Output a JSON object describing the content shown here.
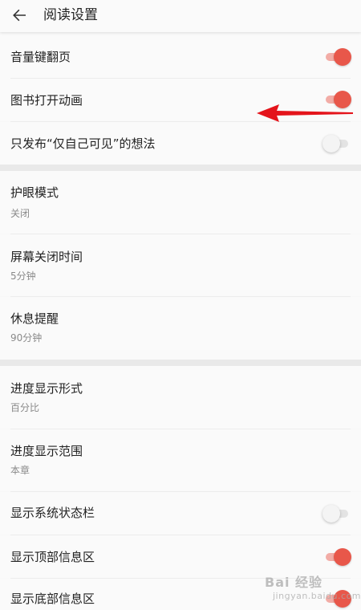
{
  "header": {
    "title": "阅读设置",
    "back_icon": "arrow-left-icon"
  },
  "section1": {
    "items": [
      {
        "label": "音量键翻页",
        "toggle_on": true
      },
      {
        "label": "图书打开动画",
        "toggle_on": true
      },
      {
        "label": "只发布“仅自己可见”的想法",
        "toggle_on": false
      }
    ]
  },
  "section2": {
    "items": [
      {
        "label": "护眼模式",
        "value": "关闭"
      },
      {
        "label": "屏幕关闭时间",
        "value": "5分钟"
      },
      {
        "label": "休息提醒",
        "value": "90分钟"
      }
    ]
  },
  "section3": {
    "items": [
      {
        "label": "进度显示形式",
        "value": "百分比"
      },
      {
        "label": "进度显示范围",
        "value": "本章"
      },
      {
        "label": "显示系统状态栏",
        "toggle_on": false
      },
      {
        "label": "显示顶部信息区",
        "toggle_on": true
      },
      {
        "label": "显示底部信息区",
        "toggle_on": true
      }
    ]
  },
  "colors": {
    "accent": "#e8574a",
    "accent_track": "#f2aca6",
    "annotation_arrow": "#e4141b"
  },
  "watermark": {
    "main": "Bai 经验",
    "sub": "jingyan.baidu.com"
  }
}
